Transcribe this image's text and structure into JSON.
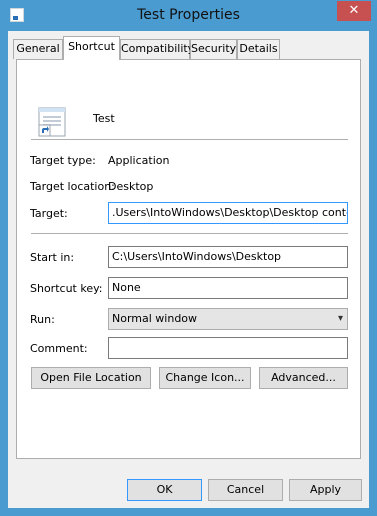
{
  "window": {
    "title": "Test Properties"
  },
  "tabs": [
    {
      "label": "General"
    },
    {
      "label": "Shortcut"
    },
    {
      "label": "Compatibility"
    },
    {
      "label": "Security"
    },
    {
      "label": "Details"
    }
  ],
  "shortcut": {
    "name": "Test",
    "target_type": {
      "label": "Target type:",
      "value": "Application"
    },
    "target_location": {
      "label": "Target location:",
      "value": "Desktop"
    },
    "target": {
      "label": "Target:",
      "value": ".Users\\IntoWindows\\Desktop\\Desktop contents\""
    },
    "start_in": {
      "label": "Start in:",
      "value": "C:\\Users\\IntoWindows\\Desktop"
    },
    "shortcut_key": {
      "label": "Shortcut key:",
      "value": "None"
    },
    "run": {
      "label": "Run:",
      "value": "Normal window"
    },
    "comment": {
      "label": "Comment:",
      "value": ""
    },
    "buttons": {
      "open_file_location": "Open File Location",
      "change_icon": "Change Icon...",
      "advanced": "Advanced..."
    }
  },
  "footer": {
    "ok": "OK",
    "cancel": "Cancel",
    "apply": "Apply"
  },
  "icons": {
    "close": "close-icon",
    "app": "shortcut-app-icon",
    "dropdown": "chevron-down-icon"
  },
  "colors": {
    "titlebar": "#4a9bd0",
    "close_button": "#c75050",
    "focus_border": "#3399ff"
  }
}
